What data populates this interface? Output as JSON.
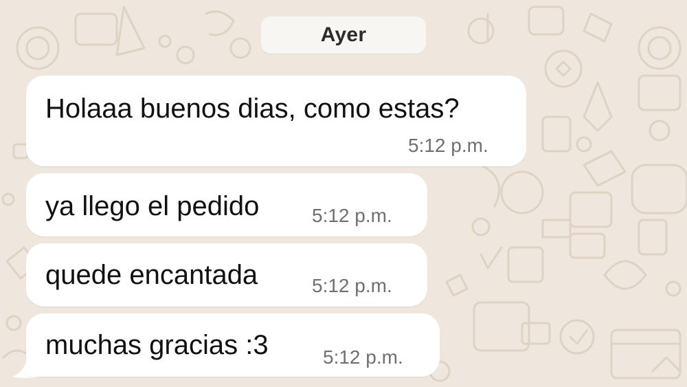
{
  "chat": {
    "date_label": "Ayer",
    "messages": [
      {
        "text": "Holaaa buenos dias, como estas?",
        "time": "5:12 p.m."
      },
      {
        "text": "ya llego el pedido",
        "time": "5:12 p.m."
      },
      {
        "text": "quede encantada",
        "time": "5:12 p.m."
      },
      {
        "text": "muchas gracias :3",
        "time": "5:12 p.m."
      }
    ]
  },
  "colors": {
    "wallpaper": "#efe7dd",
    "bubble": "#ffffff",
    "date_pill": "#f8f6f2",
    "timestamp": "#6f6f6f",
    "doodle_stroke": "#ddd2c4"
  },
  "icons": [
    "doodle-wallpaper-pattern",
    "bubble-tail"
  ]
}
